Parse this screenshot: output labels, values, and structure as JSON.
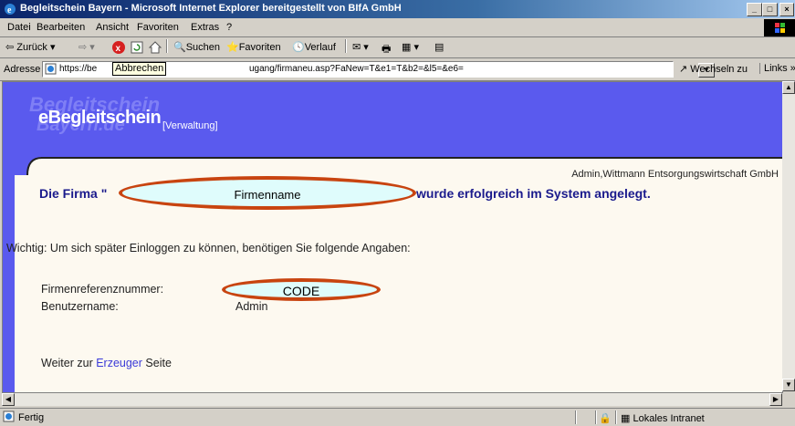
{
  "window": {
    "title": "Begleitschein Bayern - Microsoft Internet Explorer bereitgestellt von BIfA GmbH"
  },
  "menu": [
    "Datei",
    "Bearbeiten",
    "Ansicht",
    "Favoriten",
    "Extras",
    "?"
  ],
  "toolbar": {
    "back_label": "Zurück",
    "search_label": "Suchen",
    "favorites_label": "Favoriten",
    "history_label": "Verlauf"
  },
  "address": {
    "label": "Adresse",
    "url_prefix": "https://be",
    "url_suffix": "ugang/firmaneu.asp?FaNew=T&e1=T&b2=&l5=&e6=",
    "tooltip": "Abbrechen",
    "go_label": "Wechseln zu",
    "links_label": "Links"
  },
  "banner": {
    "watermark_line1": "Begleitschein",
    "watermark_line2": "Bayern.de",
    "logo": "eBegleitschein",
    "section": "[Verwaltung]"
  },
  "page": {
    "admin_user": "Admin,Wittmann Entsorgungswirtschaft GmbH",
    "success_prefix": "Die Firma \"",
    "company_placeholder": "Firmenname",
    "success_suffix": "wurde erfolgreich im System angelegt.",
    "important_note": "Wichtig: Um sich später Einloggen zu können, benötigen Sie folgende Angaben:",
    "ref_label": "Firmenreferenznummer:",
    "ref_value": "CODE",
    "username_label": "Benutzername:",
    "username_value": "Admin",
    "continue_prefix": "Weiter zur ",
    "continue_link": "Erzeuger",
    "continue_suffix": " Seite"
  },
  "status": {
    "text": "Fertig",
    "zone": "Lokales Intranet"
  },
  "colors": {
    "banner": "#5a5aee",
    "heading_text": "#1a1a8c",
    "highlight_oval_border": "#c84410",
    "highlight_oval_fill": "#dffcfc",
    "link": "#3a3ad8"
  }
}
